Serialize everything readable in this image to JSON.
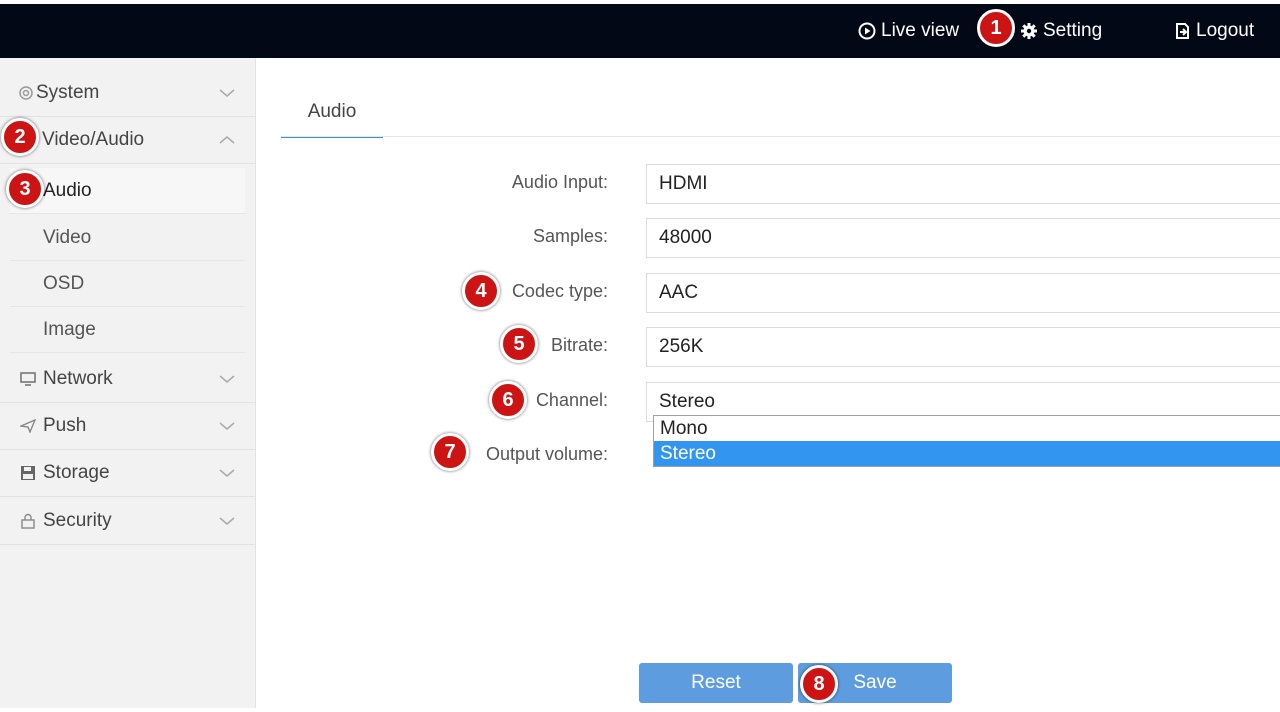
{
  "header": {
    "live_view": "Live view",
    "setting": "Setting",
    "logout": "Logout"
  },
  "sidebar": {
    "system": "System",
    "video_audio": "Video/Audio",
    "sub_items": [
      "Audio",
      "Video",
      "OSD",
      "Image"
    ],
    "network": "Network",
    "push": "Push",
    "storage": "Storage",
    "security": "Security"
  },
  "tab": {
    "label": "Audio"
  },
  "form": {
    "audio_input_label": "Audio Input:",
    "audio_input_value": "HDMI",
    "samples_label": "Samples:",
    "samples_value": "48000",
    "codec_label": "Codec type:",
    "codec_value": "AAC",
    "bitrate_label": "Bitrate:",
    "bitrate_value": "256K",
    "channel_label": "Channel:",
    "channel_value": "Stereo",
    "output_volume_label": "Output volume:"
  },
  "channel_dropdown": {
    "options": [
      "Mono",
      "Stereo"
    ],
    "selected": "Stereo"
  },
  "buttons": {
    "reset": "Reset",
    "save": "Save"
  },
  "badges": [
    "1",
    "2",
    "3",
    "4",
    "5",
    "6",
    "7",
    "8"
  ],
  "colors": {
    "topbar": "#020816",
    "accent": "#3b8ede",
    "button": "#5d9ddf",
    "dropdown_selected": "#3296f0",
    "badge": "#cc1414"
  }
}
